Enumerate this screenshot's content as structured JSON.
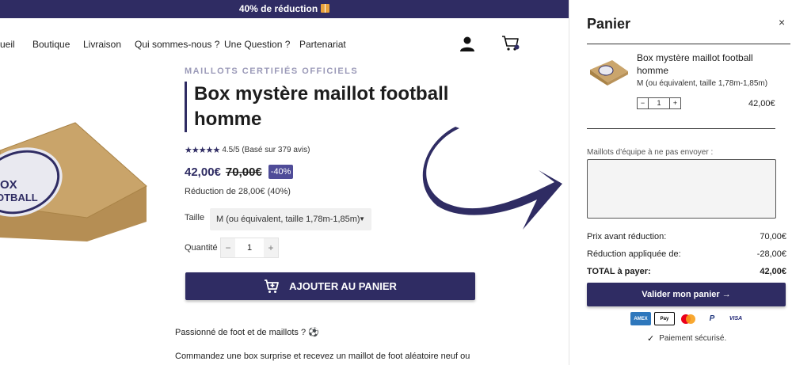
{
  "banner": {
    "text": "40% de réduction"
  },
  "nav": {
    "items": [
      "ueil",
      "Boutique",
      "Livraison",
      "Qui sommes-nous ?",
      "Une Question ?",
      "Partenariat"
    ]
  },
  "product": {
    "subtitle": "MAILLOTS CERTIFIÉS OFFICIELS",
    "title": "Box mystère maillot football homme",
    "rating_text": "4.5/5 (Basé sur 379 avis)",
    "rating_value": 4.5,
    "price": "42,00€",
    "old_price": "70,00€",
    "discount_badge": "-40%",
    "reduction": "Réduction de 28,00€ (40%)",
    "size_label": "Taille",
    "size_value": "M (ou équivalent, taille 1,78m-1,85m)",
    "qty_label": "Quantité",
    "qty_value": "1",
    "qty_minus": "−",
    "qty_plus": "+",
    "add_to_cart": "AJOUTER AU PANIER",
    "desc_line1": "Passionné de foot et de maillots ? ⚽",
    "desc_line2": "Commandez une box surprise et recevez un maillot de foot aléatoire neuf ou en",
    "box_logo_text": [
      "OX",
      "OTBALL"
    ]
  },
  "cart": {
    "title": "Panier",
    "close": "×",
    "item": {
      "name": "Box mystère maillot football homme",
      "variant": "M (ou équivalent, taille 1,78m-1,85m)",
      "qty": "1",
      "minus": "−",
      "plus": "+",
      "price": "42,00€"
    },
    "note_label": "Maillots d'équipe à ne pas envoyer :",
    "subtotal_label": "Prix avant réduction:",
    "subtotal_value": "70,00€",
    "discount_label": "Réduction appliquée de:",
    "discount_value": "-28,00€",
    "total_label": "TOTAL à payer:",
    "total_value": "42,00€",
    "checkout": "Valider mon panier →",
    "payments": [
      "AMEX",
      "Pay",
      "",
      "P",
      "VISA"
    ],
    "secure": "Paiement sécurisé."
  },
  "colors": {
    "brand": "#2f2c63",
    "badge": "#4f4c98"
  }
}
